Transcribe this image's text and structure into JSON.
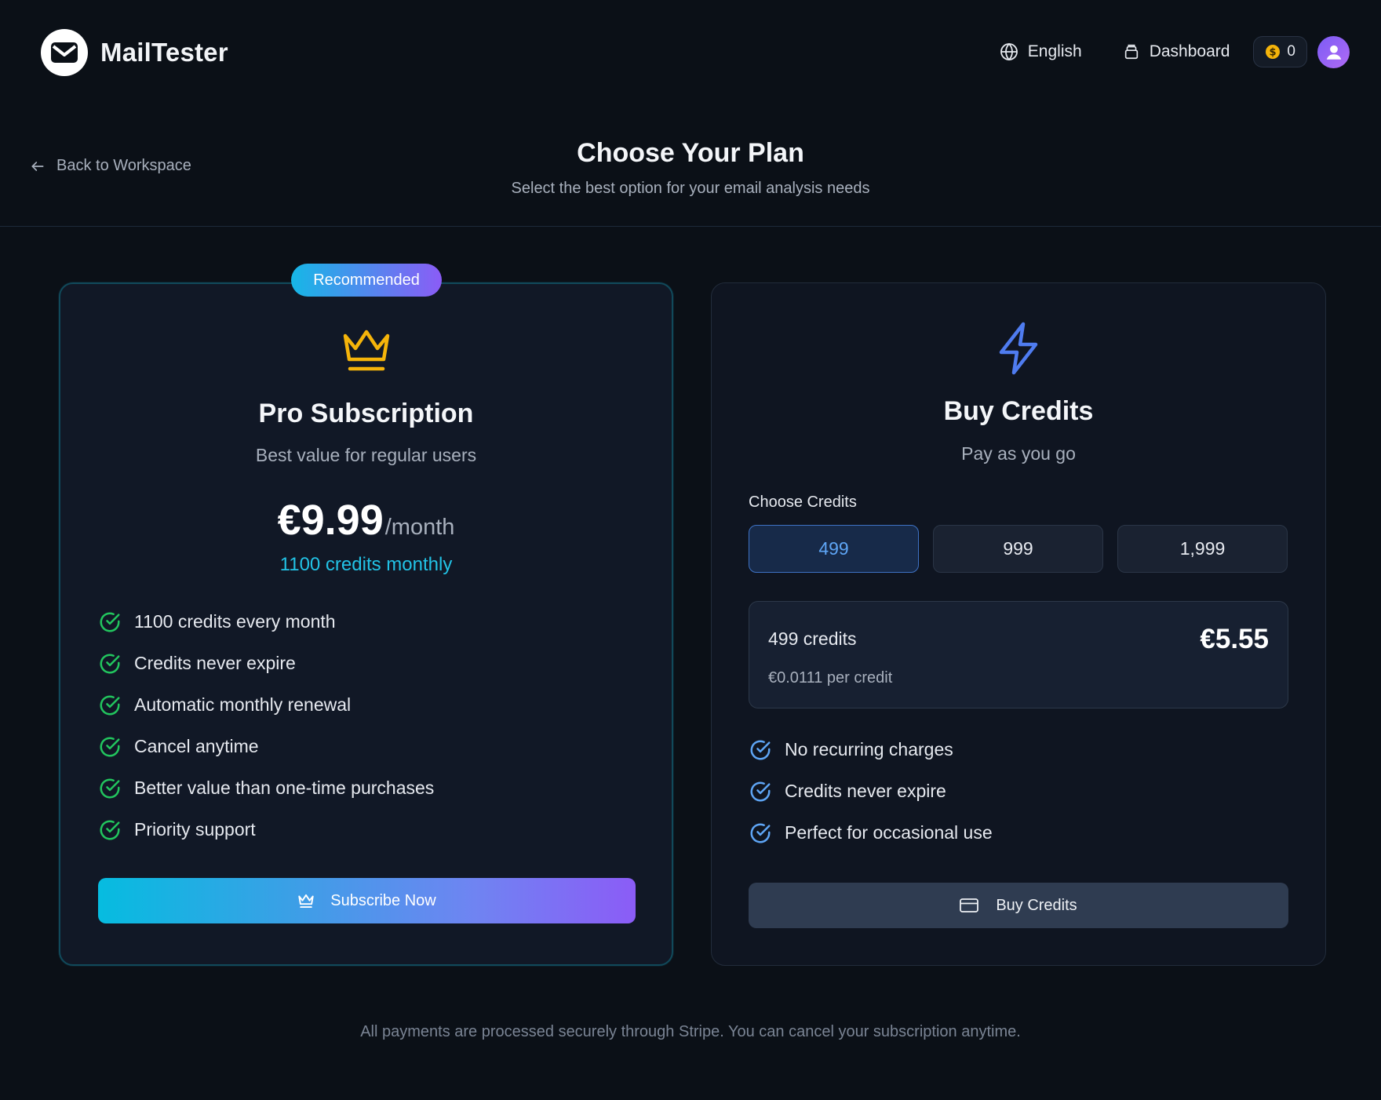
{
  "app": {
    "name": "MailTester"
  },
  "nav": {
    "language": "English",
    "dashboard": "Dashboard",
    "coin_balance": "0"
  },
  "header": {
    "back": "Back to Workspace",
    "title": "Choose Your Plan",
    "subtitle": "Select the best option for your email analysis needs"
  },
  "pro": {
    "badge": "Recommended",
    "icon": "crown-icon",
    "title": "Pro Subscription",
    "subtitle": "Best value for regular users",
    "price": "€9.99",
    "period": "/month",
    "credits_line": "1100 credits monthly",
    "features": [
      "1100 credits every month",
      "Credits never expire",
      "Automatic monthly renewal",
      "Cancel anytime",
      "Better value than one-time purchases",
      "Priority support"
    ],
    "button": "Subscribe Now"
  },
  "credits": {
    "icon": "lightning-icon",
    "title": "Buy Credits",
    "subtitle": "Pay as you go",
    "choose_label": "Choose Credits",
    "options": [
      "499",
      "999",
      "1,999"
    ],
    "selected_option": "499",
    "summary": {
      "credits": "499 credits",
      "price": "€5.55",
      "per_credit": "€0.0111 per credit"
    },
    "features": [
      "No recurring charges",
      "Credits never expire",
      "Perfect for occasional use"
    ],
    "button": "Buy Credits"
  },
  "footer": "All payments are processed securely through Stripe. You can cancel your subscription anytime.",
  "colors": {
    "background": "#0b1017",
    "accent_cyan": "#22c3e6",
    "accent_purple": "#8b5cf6",
    "check_green": "#22c55e",
    "check_blue": "#5ea5f5",
    "crown_gold": "#f5b40a"
  }
}
